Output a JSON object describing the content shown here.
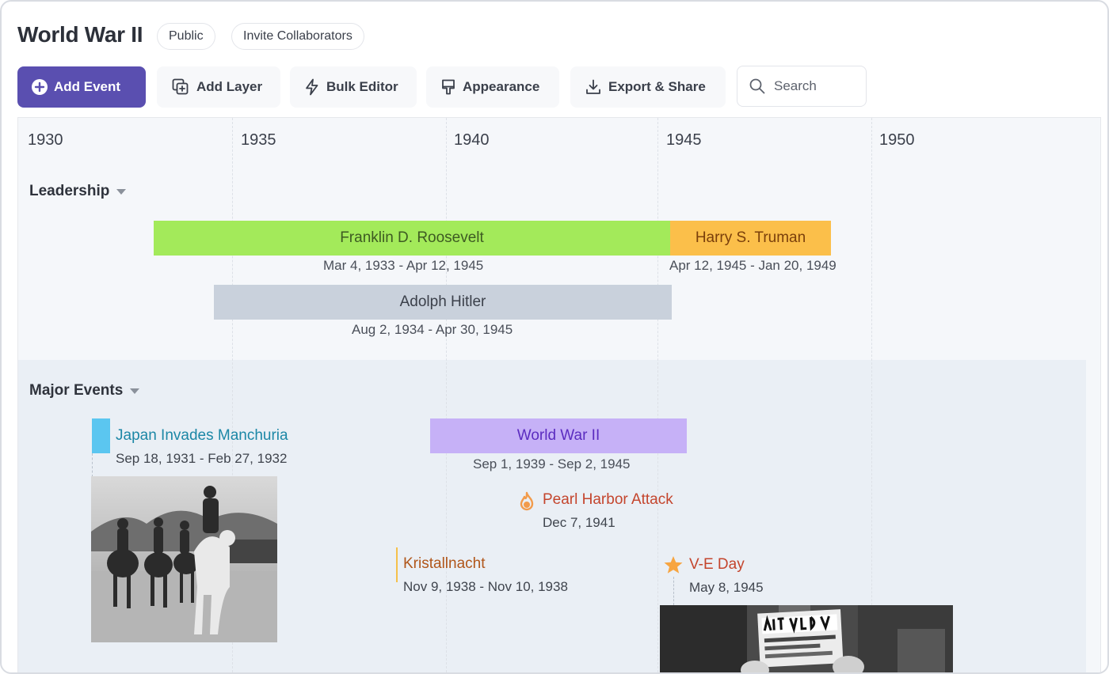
{
  "header": {
    "title": "World War II",
    "visibility_badge": "Public",
    "invite_label": "Invite Collaborators"
  },
  "toolbar": {
    "add_event": "Add Event",
    "add_layer": "Add Layer",
    "bulk_editor": "Bulk Editor",
    "appearance": "Appearance",
    "export_share": "Export & Share",
    "search_placeholder": "Search",
    "accent_color": "#5a4fb0"
  },
  "timeline": {
    "years": [
      "1930",
      "1935",
      "1940",
      "1945",
      "1950"
    ],
    "groups": {
      "leadership": {
        "label": "Leadership",
        "bars": {
          "roosevelt": {
            "name": "Franklin D. Roosevelt",
            "dates": "Mar 4, 1933 - Apr 12, 1945",
            "color": "#a3ea5a"
          },
          "truman": {
            "name": "Harry S. Truman",
            "dates": "Apr 12, 1945 - Jan 20, 1949",
            "color": "#fbbf4a"
          },
          "hitler": {
            "name": "Adolph Hitler",
            "dates": "Aug 2, 1934 - Apr 30, 1945",
            "color": "#c9d1dc"
          }
        }
      },
      "major_events": {
        "label": "Major Events",
        "events": {
          "manchuria": {
            "name": "Japan Invades Manchuria",
            "dates": "Sep 18, 1931 - Feb 27, 1932",
            "color": "#5bc6f0",
            "image": "mounted soldiers photo"
          },
          "ww2": {
            "name": "World War II",
            "dates": "Sep 1, 1939 - Sep 2, 1945",
            "color": "#c6b1f7"
          },
          "pearl_harbor": {
            "name": "Pearl Harbor Attack",
            "dates": "Dec 7, 1941",
            "icon": "fire-icon",
            "color": "#f29b4b"
          },
          "kristallnacht": {
            "name": "Kristallnacht",
            "dates": "Nov 9, 1938 - Nov 10, 1938",
            "color": "#f5c04a"
          },
          "ve_day": {
            "name": "V-E Day",
            "dates": "May 8, 1945",
            "icon": "star-icon",
            "color": "#f7a541",
            "image": "newspaper headline photo"
          }
        }
      }
    }
  }
}
